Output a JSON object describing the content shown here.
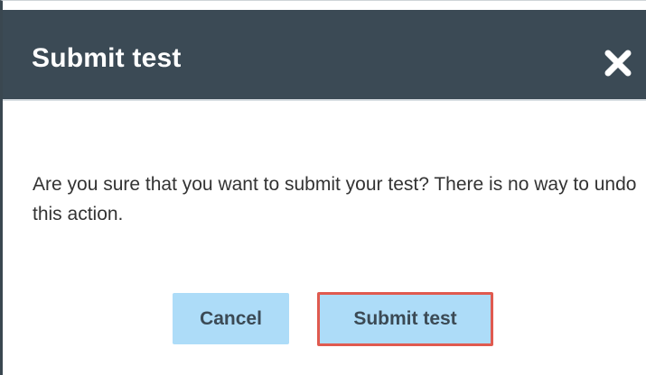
{
  "dialog": {
    "title": "Submit test",
    "close_icon": "close-icon",
    "message": "Are you sure that you want to submit your test? There is no way to undo this action.",
    "buttons": {
      "cancel_label": "Cancel",
      "submit_label": "Submit test"
    }
  },
  "colors": {
    "header_bg": "#3b4a55",
    "button_bg": "#addcf8",
    "highlight_border": "#e05a4f"
  }
}
